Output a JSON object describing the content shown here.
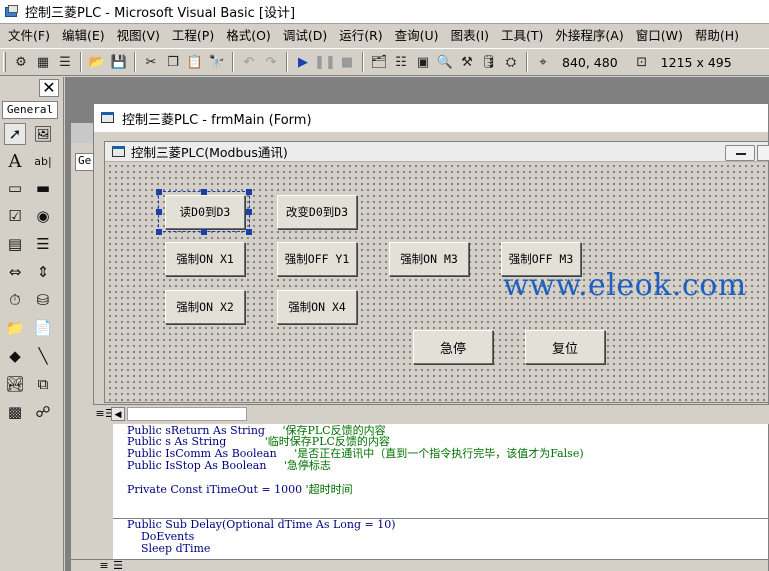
{
  "window": {
    "title": "控制三菱PLC - Microsoft Visual Basic [设计]"
  },
  "menu": [
    "文件(F)",
    "编辑(E)",
    "视图(V)",
    "工程(P)",
    "格式(O)",
    "调试(D)",
    "运行(R)",
    "查询(U)",
    "图表(I)",
    "工具(T)",
    "外接程序(A)",
    "窗口(W)",
    "帮助(H)"
  ],
  "toolbar": {
    "position": "840, 480",
    "size": "1215 x 495"
  },
  "toolbox": {
    "tab": "General",
    "close": "✕"
  },
  "form_window": {
    "title": "控制三菱PLC - frmMain (Form)"
  },
  "inner_form": {
    "title": "控制三菱PLC(Modbus通讯)"
  },
  "buttons": {
    "read_d0": "读D0到D3",
    "change_d0": "改变D0到D3",
    "force_on_x1": "强制ON X1",
    "force_off_y1": "强制OFF Y1",
    "force_on_m3": "强制ON M3",
    "force_off_m3": "强制OFF M3",
    "force_on_x2": "强制ON X2",
    "force_on_x4": "强制ON X4",
    "estop": "急停",
    "reset": "复位"
  },
  "watermark": "www.eleok.com",
  "code_window": {
    "combo": "Ge",
    "lines": [
      {
        "code": "Public sReturn As String     ",
        "comment": "'保存PLC反馈的内容"
      },
      {
        "code": "Public s As String           ",
        "comment": "'临时保存PLC反馈的内容"
      },
      {
        "code": "Public IsComm As Boolean     ",
        "comment": "'是否正在通讯中（直到一个指令执行完毕，该值才为False)"
      },
      {
        "code": "Public IsStop As Boolean     ",
        "comment": "'急停标志"
      },
      {
        "code": "Private Const iTimeOut = 1000 ",
        "comment": "'超时时间"
      },
      {
        "code": "Public Sub Delay(Optional dTime As Long = 10)",
        "comment": ""
      },
      {
        "code": "    DoEvents",
        "comment": ""
      },
      {
        "code": "    Sleep dTime",
        "comment": ""
      }
    ]
  }
}
